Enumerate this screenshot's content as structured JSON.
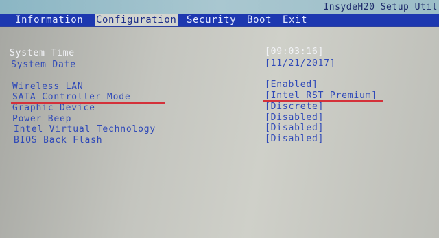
{
  "app": {
    "title": "InsydeH20 Setup Util"
  },
  "menu": {
    "tabs": [
      {
        "label": "Information"
      },
      {
        "label": "Configuration",
        "active": true
      },
      {
        "label": "Security"
      },
      {
        "label": "Boot"
      },
      {
        "label": "Exit"
      }
    ]
  },
  "settings": [
    {
      "label": "System Time",
      "value": "[09:03:16]"
    },
    {
      "label": "System Date",
      "value": "[11/21/2017]"
    },
    {
      "label": "Wireless LAN",
      "value": "[Enabled]"
    },
    {
      "label": "SATA Controller Mode",
      "value": "[Intel RST Premium]",
      "highlighted": true
    },
    {
      "label": "Graphic Device",
      "value": "[Discrete]"
    },
    {
      "label": "Power Beep",
      "value": "[Disabled]"
    },
    {
      "label": "Intel Virtual Technology",
      "value": "[Disabled]"
    },
    {
      "label": "BIOS Back Flash",
      "value": "[Disabled]"
    }
  ],
  "colors": {
    "menubar": "#1d38b0",
    "label_blue": "#2f49b8",
    "selected_white": "#f2f3f7",
    "annotation_red": "#d4313a",
    "background": "#c4c5bf"
  }
}
